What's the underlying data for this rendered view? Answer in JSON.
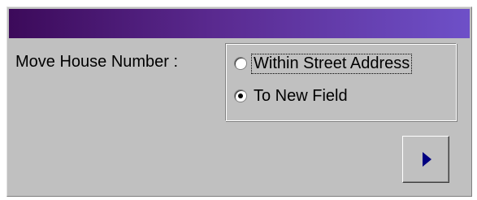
{
  "form": {
    "label": "Move House Number :",
    "options": [
      {
        "label": "Within Street Address",
        "selected": false,
        "focused": true
      },
      {
        "label": "To New Field",
        "selected": true,
        "focused": false
      }
    ]
  },
  "titlebar": {
    "gradient_start": "#3c0a5a",
    "gradient_end": "#6e50c8"
  },
  "next_button": {
    "icon": "play-triangle-right-icon",
    "icon_color": "#000080"
  }
}
